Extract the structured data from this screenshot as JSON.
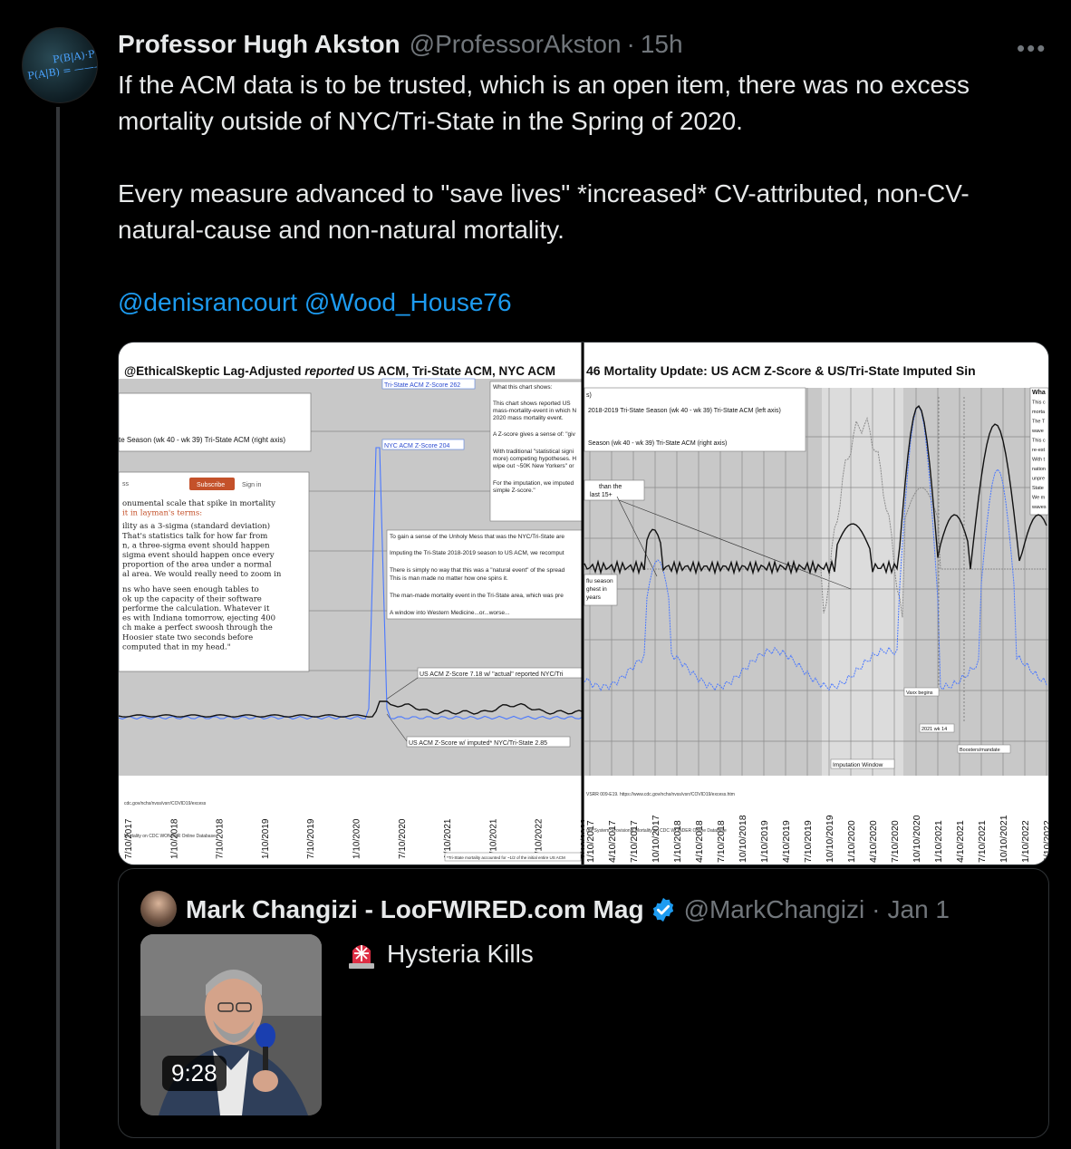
{
  "tweet": {
    "author_name": "Professor Hugh Akston",
    "author_handle": "@ProfessorAkston",
    "separator": "·",
    "time": "15h",
    "more_label": "•••",
    "avatar_formula_1": "P(B|A)·P(A)",
    "avatar_formula_2": "P(A|B) = ———— P(B)",
    "text_p1": "If the ACM data is to be trusted, which is an open item, there was no excess mortality outside of NYC/Tri-State in the Spring of 2020.",
    "text_p2": "Every measure advanced to \"save lives\" *increased* CV-attributed, non-CV-natural-cause and non-natural mortality.",
    "mention_1": "@denisrancourt",
    "mention_2": "@Wood_House76"
  },
  "image": {
    "left": {
      "title_parts": [
        "@EthicalSkeptic Lag-Adjusted ",
        "reported",
        " US ACM, Tri-State ACM, NYC ACM"
      ],
      "legend_text": "te Season (wk 40 - wk 39) Tri-State ACM (right axis)",
      "annotations": {
        "tri_state_peak": "Tri-State ACM Z-Score 262",
        "nyc_peak": "NYC ACM Z-Score 204",
        "us_actual": "US ACM Z-Score 7.18 w/ \"actual\" reported NYC/Tri",
        "us_imputed": "US ACM Z-Score w/ imputed* NYC/Tri-State 2.85"
      },
      "what_chart_shows": [
        "What this chart shows:",
        "This chart shows reported US",
        "mass-mortality-event in which N",
        "2020 mass mortality event.",
        "A Z-score gives a sense of: \"giv",
        "With traditional \"statistical signi",
        "more) competing hypotheses. H",
        "wipe out ~50K New Yorkers\" or",
        "For the imputation, we imputed",
        "simple Z-score.\""
      ],
      "unholy_mess": [
        "To gain a sense of the Unholy Mess that was the NYC/Tri-State are",
        "Imputing the Tri-State 2018-2019 season to US ACM, we recomput",
        "There is simply no way that this was a \"natural event\" of the spread",
        "This is man made no matter how one spins it.",
        "The man-made mortality event in the Tri-State area, which was pre",
        "A window into Western Medicine...or...worse..."
      ],
      "article": {
        "subscribe": "Subscribe",
        "sign_in": "Sign in",
        "nav_fragment": "ss",
        "lines": [
          "onumental scale that spike in mortality",
          "it in layman's terms:",
          "ility as a 3-sigma (standard deviation)",
          "That's statistics talk for how far from",
          "n, a three-sigma event should happen",
          "sigma event should happen once every",
          "proportion of the area under a normal",
          "al area. We would really need to zoom in",
          "ns who have seen enough tables to",
          "ok up the capacity of their software",
          "performe the calculation. Whatever it",
          "es with Indiana tomorrow, ejecting 400",
          "ch make a perfect swoosh through the",
          "Hoosier state two seconds before",
          "computed that in my head.\""
        ]
      },
      "x_ticks": [
        "7/10/2017",
        "1/10/2018",
        "7/10/2018",
        "1/10/2019",
        "7/10/2019",
        "1/10/2020",
        "7/10/2020",
        "1/10/2021",
        "7/10/2021",
        "1/10/2022",
        "7/10/2022"
      ],
      "source_1": "cdc.gov/nchs/nvss/vsrr/COVID19/excess",
      "source_2": "Mortality on CDC WONDER Online Database",
      "footnote": "*Tri-State mortality accounted for ~1/2 of the initial entire US ACM"
    },
    "right": {
      "title": "46 Mortality Update: US ACM Z-Score & US/Tri-State Imputed Sin",
      "legend_1": "2018-2019 Tri-State Season (wk 40 - wk 39) Tri-State ACM (left axis)",
      "legend_2": "Season (wk 40 - wk 39) Tri-State ACM (right axis)",
      "legend_frag": "s)",
      "note_1": "than the",
      "note_2": "last 15+",
      "flu_note": [
        "flu season",
        "ghest in",
        "years"
      ],
      "right_box": [
        "Wha",
        "This c",
        "morta",
        "The T",
        "wave",
        "This c",
        "re-est",
        "With t",
        "nation",
        "unpre",
        "State",
        "We m",
        "waves"
      ],
      "markers": {
        "imputation": "Imputation Window",
        "vaxx": "Vaxx begins",
        "wk14": "2021 wk 14",
        "boosters": "Boosters/mandate"
      },
      "x_ticks": [
        "1/10/2017",
        "4/10/2017",
        "7/10/2017",
        "10/10/2017",
        "1/10/2018",
        "4/10/2018",
        "7/10/2018",
        "10/10/2018",
        "1/10/2019",
        "4/10/2019",
        "7/10/2019",
        "10/10/2019",
        "1/10/2020",
        "4/10/2020",
        "7/10/2020",
        "10/10/2020",
        "1/10/2021",
        "4/10/2021",
        "7/10/2021",
        "10/10/2021",
        "1/10/2022",
        "4/10/2022"
      ],
      "source_1": "VSRR 009-E19. https://www.cdc.gov/nchs/nvss/vsrr/COVID19/excess.htm",
      "source_2": "ure System, Provisional Mortality on CDC WONDER Online Database"
    }
  },
  "quote": {
    "author_name": "Mark Changizi - LooFWIRED.com Mag",
    "author_handle": "@MarkChangizi",
    "separator": "·",
    "time": "Jan 1",
    "video_duration": "9:28",
    "text": "Hysteria Kills",
    "verified_icon": "verified-badge-icon",
    "siren_icon": "rotating-light-icon",
    "verified_color": "#1d9bf0"
  },
  "colors": {
    "background": "#000000",
    "text": "#e7e9ea",
    "muted": "#71767b",
    "link": "#1d9bf0",
    "border": "#2f3336"
  }
}
